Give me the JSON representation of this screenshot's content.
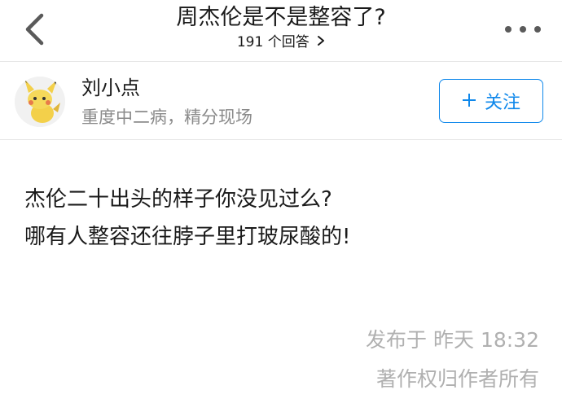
{
  "header": {
    "title": "周杰伦是不是整容了?",
    "answer_count": "191 个回答",
    "back_icon": "chevron-left-icon",
    "more_icon": "more-dots-icon"
  },
  "author": {
    "name": "刘小点",
    "bio": "重度中二病，精分现场",
    "follow_label": "关注",
    "follow_icon": "plus-icon",
    "accent_color": "#0f88eb"
  },
  "answer": {
    "lines": [
      "杰伦二十出头的样子你没见过么?",
      "哪有人整容还往脖子里打玻尿酸的!"
    ],
    "published": "发布于 昨天 18:32",
    "copyright": "著作权归作者所有"
  }
}
